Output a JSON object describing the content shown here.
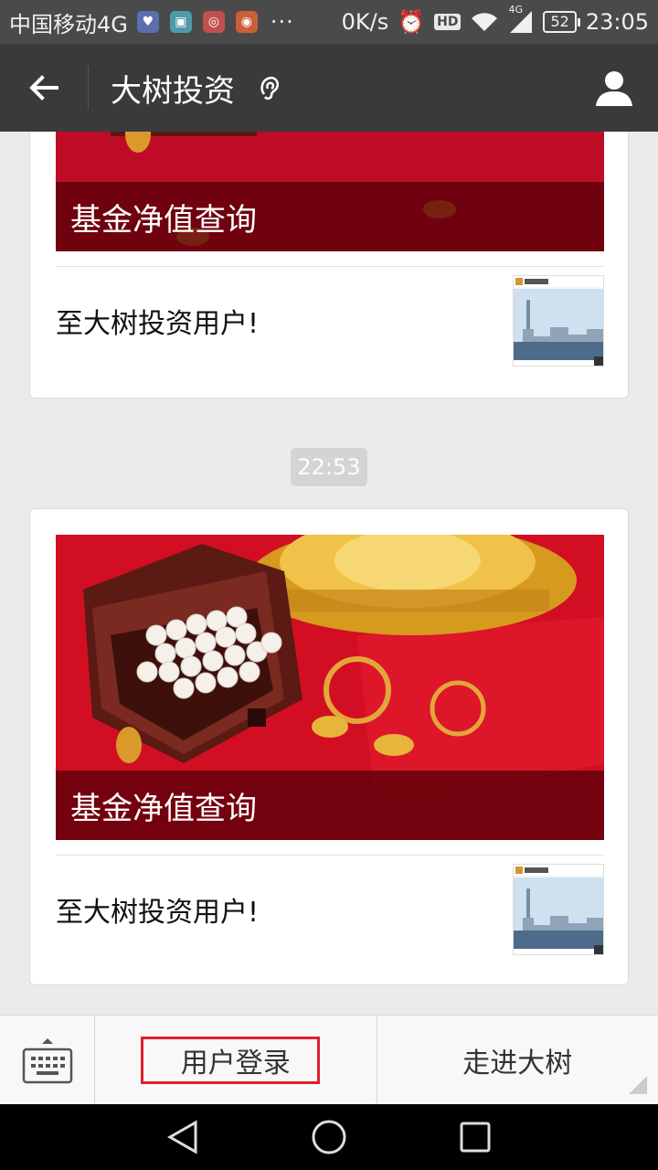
{
  "status_bar": {
    "carrier": "中国移动4G",
    "more": "···",
    "speed": "0K/s",
    "hd": "HD",
    "network": "4G",
    "battery": "52",
    "time": "23:05"
  },
  "header": {
    "title": "大树投资",
    "icons": [
      "back-arrow-icon",
      "ear-icon",
      "profile-icon"
    ]
  },
  "messages": [
    {
      "cover_title": "基金净值查询",
      "item_title": "至大树投资用户!"
    },
    {
      "cover_title": "基金净值查询",
      "item_title": "至大树投资用户!"
    }
  ],
  "timestamp": "22:53",
  "bottom_menu": {
    "items": [
      {
        "label": "用户登录"
      },
      {
        "label": "走进大树"
      }
    ]
  },
  "colors": {
    "titlebar": "#3a3a3c",
    "cover_red": "#c8102e",
    "highlight": "#e0202a"
  }
}
